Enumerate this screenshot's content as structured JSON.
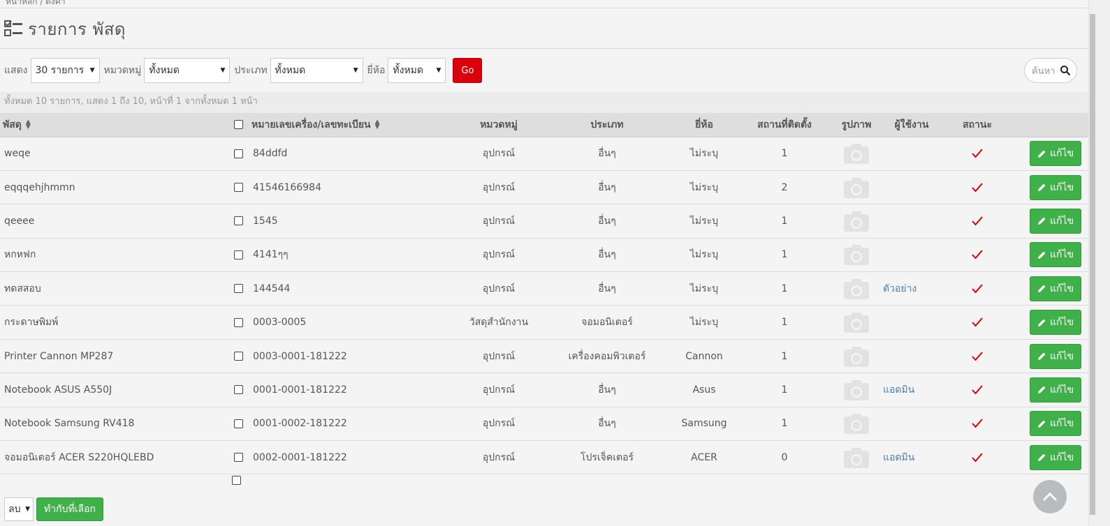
{
  "breadcrumb": "หน้าหลัก / ตั้งค่า",
  "page": {
    "title": "รายการ พัสดุ"
  },
  "filters": {
    "show_label": "แสดง",
    "show_value": "30 รายการ",
    "category_label": "หมวดหมู่",
    "category_value": "ทั้งหมด",
    "type_label": "ประเภท",
    "type_value": "ทั้งหมด",
    "brand_label": "ยี่ห้อ",
    "brand_value": "ทั้งหมด",
    "go_label": "Go"
  },
  "search": {
    "placeholder": "ค้นหา"
  },
  "summary": "ทั้งหมด 10 รายการ, แสดง 1 ถึง 10, หน้าที่ 1 จากทั้งหมด 1 หน้า",
  "table": {
    "headers": {
      "item": "พัสดุ",
      "serial": "หมายเลขเครื่อง/เลขทะเบียน",
      "category": "หมวดหมู่",
      "type": "ประเภท",
      "brand": "ยี่ห้อ",
      "location": "สถานที่ติดตั้ง",
      "image": "รูปภาพ",
      "user": "ผู้ใช้งาน",
      "status": "สถานะ"
    },
    "edit_label": "แก้ไข",
    "rows": [
      {
        "item": "weqe",
        "serial": "84ddfd",
        "category": "อุปกรณ์",
        "type": "อื่นๆ",
        "brand": "ไม่ระบุ",
        "location": "1",
        "user": ""
      },
      {
        "item": "eqqqehjhmmn",
        "serial": "41546166984",
        "category": "อุปกรณ์",
        "type": "อื่นๆ",
        "brand": "ไม่ระบุ",
        "location": "2",
        "user": ""
      },
      {
        "item": "qeeee",
        "serial": "1545",
        "category": "อุปกรณ์",
        "type": "อื่นๆ",
        "brand": "ไม่ระบุ",
        "location": "1",
        "user": ""
      },
      {
        "item": "หกหฟก",
        "serial": "4141ๆๆ",
        "category": "อุปกรณ์",
        "type": "อื่นๆ",
        "brand": "ไม่ระบุ",
        "location": "1",
        "user": ""
      },
      {
        "item": "ทดสสอบ",
        "serial": "144544",
        "category": "อุปกรณ์",
        "type": "อื่นๆ",
        "brand": "ไม่ระบุ",
        "location": "1",
        "user": "ตัวอย่าง"
      },
      {
        "item": "กระดาษพิมพ์",
        "serial": "0003-0005",
        "category": "วัสดุสำนักงาน",
        "type": "จอมอนิเตอร์",
        "brand": "ไม่ระบุ",
        "location": "1",
        "user": ""
      },
      {
        "item": "Printer Cannon MP287",
        "serial": "0003-0001-181222",
        "category": "อุปกรณ์",
        "type": "เครื่องคอมพิวเตอร์",
        "brand": "Cannon",
        "location": "1",
        "user": ""
      },
      {
        "item": "Notebook ASUS A550J",
        "serial": "0001-0001-181222",
        "category": "อุปกรณ์",
        "type": "อื่นๆ",
        "brand": "Asus",
        "location": "1",
        "user": "แอดมิน"
      },
      {
        "item": "Notebook Samsung RV418",
        "serial": "0001-0002-181222",
        "category": "อุปกรณ์",
        "type": "อื่นๆ",
        "brand": "Samsung",
        "location": "1",
        "user": ""
      },
      {
        "item": "จอมอนิเตอร์ ACER S220HQLEBD",
        "serial": "0002-0001-181222",
        "category": "อุปกรณ์",
        "type": "โปรเจ็คเตอร์",
        "brand": "ACER",
        "location": "0",
        "user": "แอดมิน"
      }
    ]
  },
  "bulk": {
    "action_value": "ลบ",
    "apply_label": "ทำกับที่เลือก"
  },
  "colors": {
    "go": "#d9000b",
    "edit": "#3fb04a",
    "status_ok": "#d9000b",
    "link": "#4a7fb5"
  }
}
